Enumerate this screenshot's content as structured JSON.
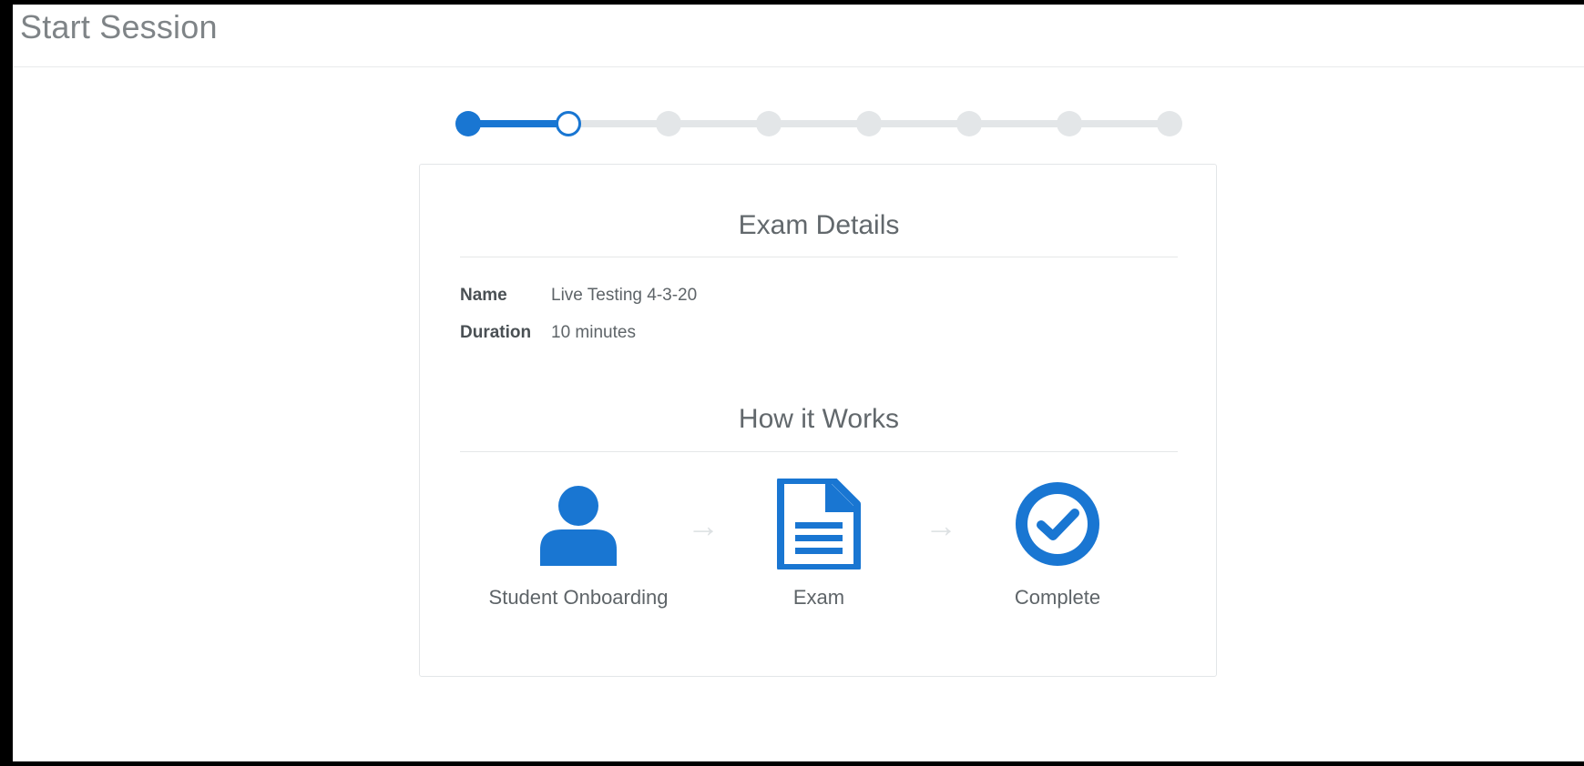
{
  "page": {
    "title": "Start Session"
  },
  "stepper": {
    "total_steps": 8,
    "completed_steps": 1,
    "current_step": 2,
    "accent_color": "#1976d2",
    "inactive_color": "#e3e6e8"
  },
  "exam_details": {
    "heading": "Exam Details",
    "name_label": "Name",
    "name_value": "Live Testing 4-3-20",
    "duration_label": "Duration",
    "duration_value": "10 minutes"
  },
  "how_it_works": {
    "heading": "How it Works",
    "steps": [
      {
        "label": "Student Onboarding",
        "icon": "user-icon"
      },
      {
        "label": "Exam",
        "icon": "document-icon"
      },
      {
        "label": "Complete",
        "icon": "check-circle-icon"
      }
    ],
    "arrow": "→"
  }
}
